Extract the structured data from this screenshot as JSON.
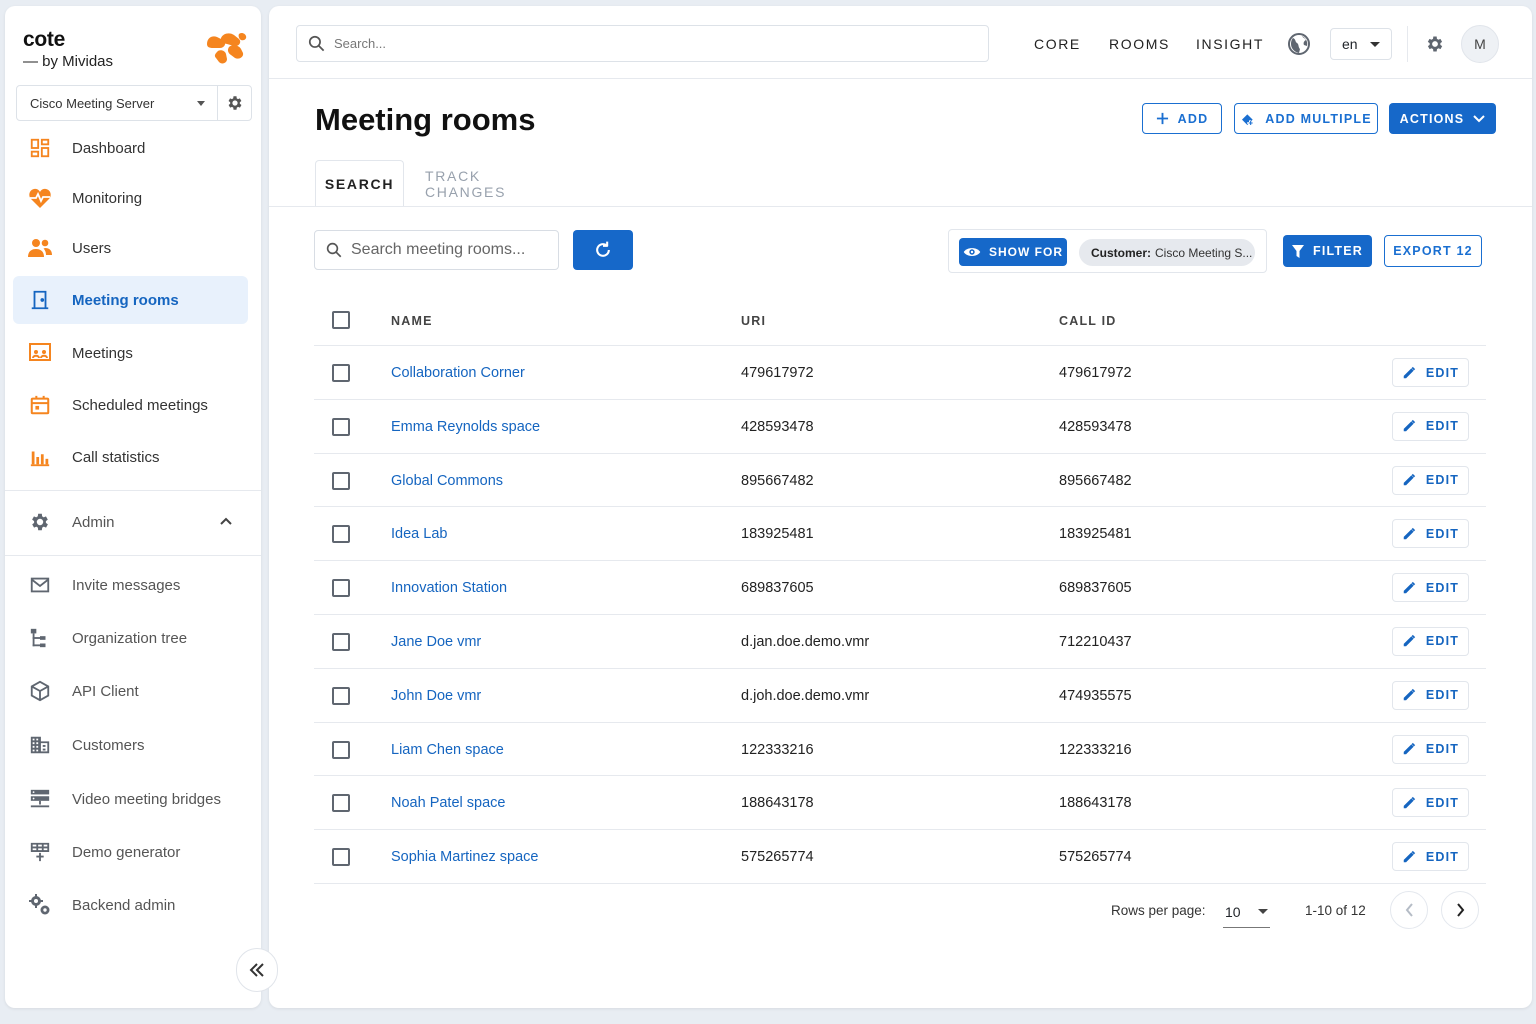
{
  "brand": {
    "name": "cote",
    "sub": "— by Mividas",
    "server": "Cisco Meeting Server"
  },
  "colors": {
    "accent": "#1668c9",
    "link": "#1565c0",
    "brand_orange": "#f5851f"
  },
  "sidebar": {
    "items": [
      {
        "label": "Dashboard",
        "icon": "dashboard-icon"
      },
      {
        "label": "Monitoring",
        "icon": "heart-pulse-icon"
      },
      {
        "label": "Users",
        "icon": "users-icon"
      },
      {
        "label": "Meeting rooms",
        "icon": "door-icon",
        "active": true
      },
      {
        "label": "Meetings",
        "icon": "meetings-icon"
      },
      {
        "label": "Scheduled meetings",
        "icon": "calendar-icon"
      },
      {
        "label": "Call statistics",
        "icon": "bar-chart-icon"
      }
    ],
    "admin": {
      "label": "Admin",
      "icon": "gear-icon"
    },
    "admin_items": [
      {
        "label": "Invite messages",
        "icon": "mail-icon"
      },
      {
        "label": "Organization tree",
        "icon": "tree-icon"
      },
      {
        "label": "API Client",
        "icon": "cube-icon"
      },
      {
        "label": "Customers",
        "icon": "building-icon"
      },
      {
        "label": "Video meeting bridges",
        "icon": "server-icon"
      },
      {
        "label": "Demo generator",
        "icon": "grid-plus-icon"
      },
      {
        "label": "Backend admin",
        "icon": "gears-icon"
      }
    ]
  },
  "topbar": {
    "search_placeholder": "Search...",
    "links": [
      "CORE",
      "ROOMS",
      "INSIGHT"
    ],
    "lang": "en",
    "avatar": "M"
  },
  "page": {
    "title": "Meeting rooms",
    "add": "ADD",
    "add_multiple": "ADD MULTIPLE",
    "actions": "ACTIONS",
    "tabs": [
      "SEARCH",
      "TRACK CHANGES"
    ]
  },
  "toolbar": {
    "search_placeholder": "Search meeting rooms...",
    "show_for": "SHOW FOR",
    "customer_key": "Customer:",
    "customer_value": "Cisco Meeting S...",
    "filter": "FILTER",
    "export": "EXPORT 12"
  },
  "table": {
    "headers": [
      "NAME",
      "URI",
      "CALL ID"
    ],
    "edit_label": "EDIT",
    "rows": [
      {
        "name": "Collaboration Corner",
        "uri": "479617972",
        "call_id": "479617972"
      },
      {
        "name": "Emma Reynolds space",
        "uri": "428593478",
        "call_id": "428593478"
      },
      {
        "name": "Global Commons",
        "uri": "895667482",
        "call_id": "895667482"
      },
      {
        "name": "Idea Lab",
        "uri": "183925481",
        "call_id": "183925481"
      },
      {
        "name": "Innovation Station",
        "uri": "689837605",
        "call_id": "689837605"
      },
      {
        "name": "Jane Doe vmr",
        "uri": "d.jan.doe.demo.vmr",
        "call_id": "712210437"
      },
      {
        "name": "John Doe vmr",
        "uri": "d.joh.doe.demo.vmr",
        "call_id": "474935575"
      },
      {
        "name": "Liam Chen space",
        "uri": "122333216",
        "call_id": "122333216"
      },
      {
        "name": "Noah Patel space",
        "uri": "188643178",
        "call_id": "188643178"
      },
      {
        "name": "Sophia Martinez space",
        "uri": "575265774",
        "call_id": "575265774"
      }
    ]
  },
  "pagination": {
    "rows_per_page_label": "Rows per page:",
    "rows_per_page": "10",
    "range": "1-10 of 12"
  }
}
